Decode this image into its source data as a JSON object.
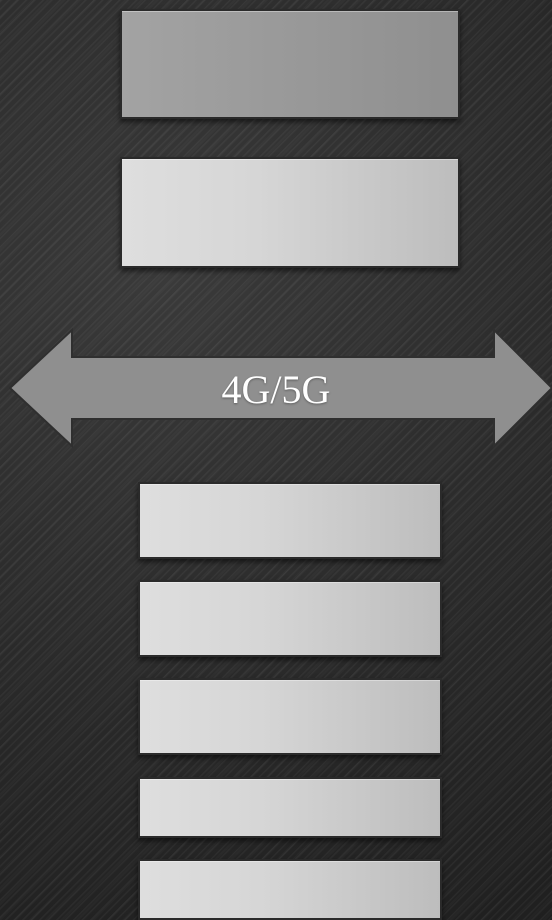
{
  "diagram": {
    "arrow_label": "4G/5G",
    "colors": {
      "background": "#2a2a2a",
      "arrow": "#8f8f8f",
      "box_dark": "#9a9a9a",
      "box_light": "#d6d6d6",
      "text": "#ffffff"
    },
    "top_group": {
      "boxes": [
        {
          "name": "top-box-1",
          "label": ""
        },
        {
          "name": "top-box-2",
          "label": ""
        }
      ]
    },
    "bottom_group": {
      "boxes": [
        {
          "name": "bottom-box-1",
          "label": ""
        },
        {
          "name": "bottom-box-2",
          "label": ""
        },
        {
          "name": "bottom-box-3",
          "label": ""
        },
        {
          "name": "bottom-box-4",
          "label": ""
        },
        {
          "name": "bottom-box-5",
          "label": ""
        }
      ]
    }
  }
}
